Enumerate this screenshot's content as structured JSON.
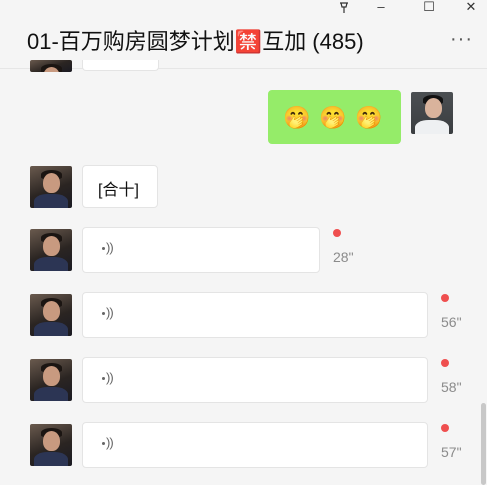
{
  "window": {
    "pin_icon": "pin-icon",
    "minimize_glyph": "–",
    "maximize_glyph": "☐",
    "close_glyph": "✕"
  },
  "chat": {
    "title": "01-百万购房圆梦计划🈲互加 (485)",
    "more_glyph": "···"
  },
  "messages": [
    {
      "sender": "me",
      "type": "emoji",
      "content": [
        "🤭",
        "🤭",
        "🤭"
      ]
    },
    {
      "sender": "other",
      "type": "text",
      "text": "[合十]"
    },
    {
      "sender": "other",
      "type": "voice",
      "duration": "28\"",
      "unread": true
    },
    {
      "sender": "other",
      "type": "voice",
      "duration": "56\"",
      "unread": true
    },
    {
      "sender": "other",
      "type": "voice",
      "duration": "58\"",
      "unread": true
    },
    {
      "sender": "other",
      "type": "voice",
      "duration": "57\"",
      "unread": true
    }
  ],
  "colors": {
    "my_bubble": "#95ec69",
    "other_bubble": "#ffffff",
    "unread_dot": "#ef4f4f",
    "background": "#f5f5f5"
  }
}
